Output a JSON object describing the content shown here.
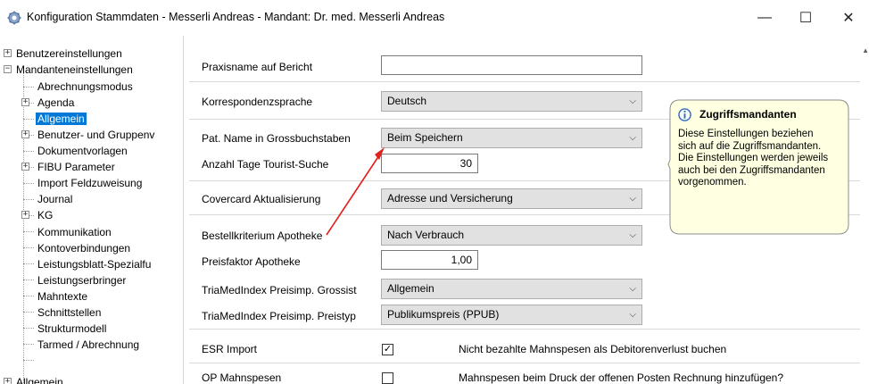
{
  "window": {
    "title": "Konfiguration Stammdaten - Messerli Andreas - Mandant: Dr. med. Messerli Andreas",
    "minimize": "—",
    "maximize": "☐",
    "close": "✕"
  },
  "tree": {
    "items": [
      {
        "label": "Benutzereinstellungen",
        "exp": "+"
      },
      {
        "label": "Mandanteneinstellungen",
        "exp": "−"
      },
      {
        "label": "Abrechnungsmodus"
      },
      {
        "label": "Agenda",
        "exp": "+"
      },
      {
        "label": "Allgemein",
        "selected": true
      },
      {
        "label": "Benutzer- und Gruppenv",
        "exp": "+"
      },
      {
        "label": "Dokumentvorlagen"
      },
      {
        "label": "FIBU Parameter",
        "exp": "+"
      },
      {
        "label": "Import Feldzuweisung"
      },
      {
        "label": "Journal"
      },
      {
        "label": "KG",
        "exp": "+"
      },
      {
        "label": "Kommunikation"
      },
      {
        "label": "Kontoverbindungen"
      },
      {
        "label": "Leistungsblatt-Spezialfu"
      },
      {
        "label": "Leistungserbringer"
      },
      {
        "label": "Mahntexte"
      },
      {
        "label": "Schnittstellen"
      },
      {
        "label": "Strukturmodell"
      },
      {
        "label": "Tarmed / Abrechnung"
      },
      {
        "label": "Allgemein",
        "exp": "+"
      }
    ]
  },
  "form": {
    "praxisname_label": "Praxisname auf Bericht",
    "praxisname_value": "",
    "korrespondenz_label": "Korrespondenzsprache",
    "korrespondenz_value": "Deutsch",
    "pat_name_label": "Pat. Name in Grossbuchstaben",
    "pat_name_value": "Beim Speichern",
    "tourist_label": "Anzahl Tage Tourist-Suche",
    "tourist_value": "30",
    "covercard_label": "Covercard Aktualisierung",
    "covercard_value": "Adresse und Versicherung",
    "bestell_label": "Bestellkriterium Apotheke",
    "bestell_value": "Nach Verbrauch",
    "preisfaktor_label": "Preisfaktor Apotheke",
    "preisfaktor_value": "1,00",
    "tria_grossist_label": "TriaMedIndex Preisimp. Grossist",
    "tria_grossist_value": "Allgemein",
    "tria_preistyp_label": "TriaMedIndex Preisimp. Preistyp",
    "tria_preistyp_value": "Publikumspreis (PPUB)",
    "esr_label": "ESR Import",
    "esr_checked": "✓",
    "esr_option": "Nicht bezahlte Mahnspesen als Debitorenverlust buchen",
    "op_label": "OP Mahnspesen",
    "op_checked": "",
    "op_option": "Mahnspesen beim Druck der offenen Posten Rechnung hinzufügen?"
  },
  "callout": {
    "title": "Zugriffsmandanten",
    "body": "Diese Einstellungen beziehen sich auf die Zugriffsmandanten. Die Einstellungen werden jeweils auch bei den Zugriffsmandanten vorgenommen.",
    "icon": "info-icon"
  },
  "colors": {
    "selection": "#0078d7",
    "arrow": "#e02020",
    "callout_bg": "#ffffe1"
  }
}
